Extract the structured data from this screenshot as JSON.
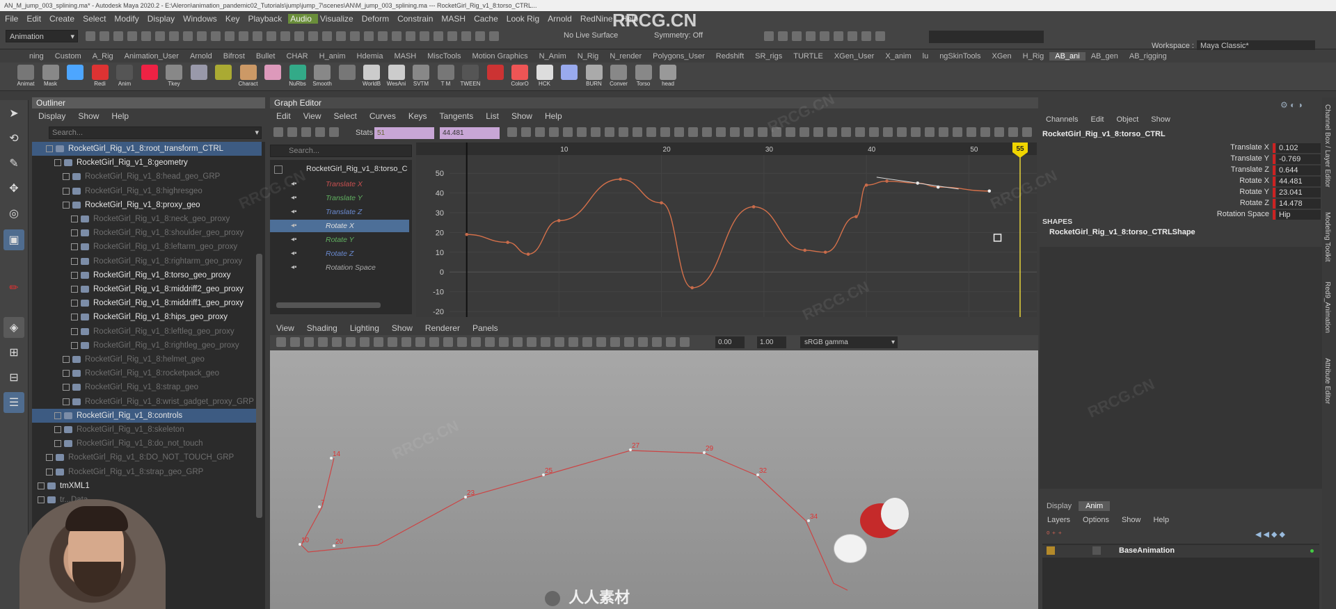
{
  "window": {
    "title": "AN_M_jump_003_splining.ma* - Autodesk Maya 2020.2 - E:\\Aleron\\animation_pandemic02_Tutorials\\jump\\jump_7\\scenes\\AN\\M_jump_003_splining.ma --- RocketGirl_Rig_v1_8:torso_CTRL..."
  },
  "watermark": "RRCG.CN",
  "menubar": [
    "File",
    "Edit",
    "Create",
    "Select",
    "Modify",
    "Display",
    "Windows",
    "Key",
    "Playback",
    "Audio",
    "Visualize",
    "Deform",
    "Constrain",
    "MASH",
    "Cache",
    "Look Rig",
    "Arnold",
    "RedNine",
    "Help"
  ],
  "statusline": {
    "mode": "Animation",
    "live_surface": "No Live Surface",
    "symmetry": "Symmetry: Off",
    "workspace_label": "Workspace :",
    "workspace": "Maya Classic*"
  },
  "shelf_tabs": [
    "ning",
    "Custom",
    "A_Rig",
    "Animation_User",
    "Arnold",
    "Bifrost",
    "Bullet",
    "CHAR",
    "H_anim",
    "Hdemia",
    "MASH",
    "MiscTools",
    "Motion Graphics",
    "N_Anim",
    "N_Rig",
    "N_render",
    "Polygons_User",
    "Redshift",
    "SR_rigs",
    "TURTLE",
    "XGen_User",
    "X_anim",
    "lu",
    "ngSkinTools",
    "XGen",
    "H_Rig",
    "AB_ani",
    "AB_gen",
    "AB_rigging"
  ],
  "shelf_active": "AB_ani",
  "shelf_items": [
    "Animat",
    "Mask",
    "",
    "Redi",
    "Anim",
    "",
    "Tkey",
    "",
    "",
    "Charact",
    "",
    "NuRbs",
    "Smooth",
    "",
    "WorldB",
    "WesAni",
    "SVTM",
    "T M",
    "TWEEN",
    "",
    "ColorO",
    "HCK",
    "",
    "BURN",
    "Conver",
    "Torso",
    "head"
  ],
  "outliner": {
    "title": "Outliner",
    "menu": [
      "Display",
      "Show",
      "Help"
    ],
    "search_placeholder": "Search...",
    "rows": [
      {
        "label": "RocketGirl_Rig_v1_8:root_transform_CTRL",
        "indent": 2,
        "style": "sel"
      },
      {
        "label": "RocketGirl_Rig_v1_8:geometry",
        "indent": 3,
        "style": "normal"
      },
      {
        "label": "RocketGirl_Rig_v1_8:head_geo_GRP",
        "indent": 4,
        "style": "dim"
      },
      {
        "label": "RocketGirl_Rig_v1_8:highresgeo",
        "indent": 4,
        "style": "dim"
      },
      {
        "label": "RocketGirl_Rig_v1_8:proxy_geo",
        "indent": 4,
        "style": "normal"
      },
      {
        "label": "RocketGirl_Rig_v1_8:neck_geo_proxy",
        "indent": 5,
        "style": "dim"
      },
      {
        "label": "RocketGirl_Rig_v1_8:shoulder_geo_proxy",
        "indent": 5,
        "style": "dim"
      },
      {
        "label": "RocketGirl_Rig_v1_8:leftarm_geo_proxy",
        "indent": 5,
        "style": "dim"
      },
      {
        "label": "RocketGirl_Rig_v1_8:rightarm_geo_proxy",
        "indent": 5,
        "style": "dim"
      },
      {
        "label": "RocketGirl_Rig_v1_8:torso_geo_proxy",
        "indent": 5,
        "style": "normal"
      },
      {
        "label": "RocketGirl_Rig_v1_8:middriff2_geo_proxy",
        "indent": 5,
        "style": "normal"
      },
      {
        "label": "RocketGirl_Rig_v1_8:middriff1_geo_proxy",
        "indent": 5,
        "style": "normal"
      },
      {
        "label": "RocketGirl_Rig_v1_8:hips_geo_proxy",
        "indent": 5,
        "style": "normal"
      },
      {
        "label": "RocketGirl_Rig_v1_8:leftleg_geo_proxy",
        "indent": 5,
        "style": "dim"
      },
      {
        "label": "RocketGirl_Rig_v1_8:rightleg_geo_proxy",
        "indent": 5,
        "style": "dim"
      },
      {
        "label": "RocketGirl_Rig_v1_8:helmet_geo",
        "indent": 4,
        "style": "dim"
      },
      {
        "label": "RocketGirl_Rig_v1_8:rocketpack_geo",
        "indent": 4,
        "style": "dim"
      },
      {
        "label": "RocketGirl_Rig_v1_8:strap_geo",
        "indent": 4,
        "style": "dim"
      },
      {
        "label": "RocketGirl_Rig_v1_8:wrist_gadget_proxy_GRP",
        "indent": 4,
        "style": "dim"
      },
      {
        "label": "RocketGirl_Rig_v1_8:controls",
        "indent": 3,
        "style": "sel"
      },
      {
        "label": "RocketGirl_Rig_v1_8:skeleton",
        "indent": 3,
        "style": "dim"
      },
      {
        "label": "RocketGirl_Rig_v1_8:do_not_touch",
        "indent": 3,
        "style": "dim"
      },
      {
        "label": "RocketGirl_Rig_v1_8:DO_NOT_TOUCH_GRP",
        "indent": 2,
        "style": "dim"
      },
      {
        "label": "RocketGirl_Rig_v1_8:strap_geo_GRP",
        "indent": 2,
        "style": "dim"
      },
      {
        "label": "tmXML1",
        "indent": 1,
        "style": "normal"
      },
      {
        "label": "tr...Data",
        "indent": 1,
        "style": "dim"
      }
    ]
  },
  "graph_editor": {
    "title": "Graph Editor",
    "menu": [
      "Edit",
      "View",
      "Select",
      "Curves",
      "Keys",
      "Tangents",
      "List",
      "Show",
      "Help"
    ],
    "stats_label": "Stats",
    "stats_frame": "51",
    "stats_value": "44.481",
    "search_placeholder": "Search...",
    "node": "RocketGirl_Rig_v1_8:torso_C",
    "channels": [
      {
        "label": "Translate X",
        "color": "#c85050"
      },
      {
        "label": "Translate Y",
        "color": "#60b060"
      },
      {
        "label": "Translate Z",
        "color": "#6a8ad0"
      },
      {
        "label": "Rotate X",
        "color": "#e0e0e0"
      },
      {
        "label": "Rotate Y",
        "color": "#60b060"
      },
      {
        "label": "Rotate Z",
        "color": "#6a8ad0"
      },
      {
        "label": "Rotation Space",
        "color": "#aaaaaa"
      }
    ],
    "selected_channel": 3,
    "ruler": [
      "10",
      "20",
      "30",
      "40",
      "50"
    ],
    "y_ticks": [
      "50",
      "40",
      "30",
      "20",
      "10",
      "0",
      "-10",
      "-20"
    ],
    "current_frame": "55"
  },
  "chart_data": {
    "type": "line",
    "title": "",
    "xlabel": "",
    "ylabel": "",
    "xlim": [
      0,
      55
    ],
    "ylim": [
      -20,
      55
    ],
    "x_ticks": [
      10,
      20,
      30,
      40,
      50
    ],
    "y_ticks": [
      50,
      40,
      30,
      20,
      10,
      0,
      -10,
      -20
    ],
    "grid": true,
    "series": [
      {
        "name": "Rotate X",
        "color": "#d4704a",
        "points": [
          [
            1,
            19
          ],
          [
            5,
            15
          ],
          [
            7,
            9
          ],
          [
            10,
            26
          ],
          [
            16,
            47
          ],
          [
            20,
            35
          ],
          [
            23,
            -8
          ],
          [
            29,
            33
          ],
          [
            34,
            11
          ],
          [
            36,
            10
          ],
          [
            39,
            28
          ],
          [
            40,
            44
          ],
          [
            42,
            46
          ],
          [
            45,
            45
          ],
          [
            47,
            43
          ],
          [
            52,
            41
          ]
        ]
      }
    ]
  },
  "viewport": {
    "menu": [
      "View",
      "Shading",
      "Lighting",
      "Show",
      "Renderer",
      "Panels"
    ],
    "field1": "0.00",
    "field2": "1.00",
    "colorspace": "sRGB gamma",
    "frame_labels": [
      {
        "t": "14"
      },
      {
        "t": "7"
      },
      {
        "t": "10"
      },
      {
        "t": "20"
      },
      {
        "t": "23"
      },
      {
        "t": "25"
      },
      {
        "t": "27"
      },
      {
        "t": "29"
      },
      {
        "t": "32"
      },
      {
        "t": "34"
      }
    ],
    "logo_text": "人人素材"
  },
  "channel_box": {
    "menu": [
      "Channels",
      "Edit",
      "Object",
      "Show"
    ],
    "node": "RocketGirl_Rig_v1_8:torso_CTRL",
    "attrs": [
      {
        "label": "Translate X",
        "value": "0.102"
      },
      {
        "label": "Translate Y",
        "value": "-0.769"
      },
      {
        "label": "Translate Z",
        "value": "0.644"
      },
      {
        "label": "Rotate X",
        "value": "44.481"
      },
      {
        "label": "Rotate Y",
        "value": "23.041"
      },
      {
        "label": "Rotate Z",
        "value": "14.478"
      },
      {
        "label": "Rotation Space",
        "value": "Hip"
      }
    ],
    "shapes_label": "SHAPES",
    "shape_node": "RocketGirl_Rig_v1_8:torso_CTRLShape"
  },
  "layer_editor": {
    "tabs": [
      "Display",
      "Anim"
    ],
    "active_tab": "Anim",
    "menu": [
      "Layers",
      "Options",
      "Show",
      "Help"
    ],
    "layer": "BaseAnimation"
  },
  "side_tabs": [
    "Channel Box / Layer Editor",
    "Modeling Toolkit",
    "Red9_Animation",
    "Attribute Editor"
  ]
}
